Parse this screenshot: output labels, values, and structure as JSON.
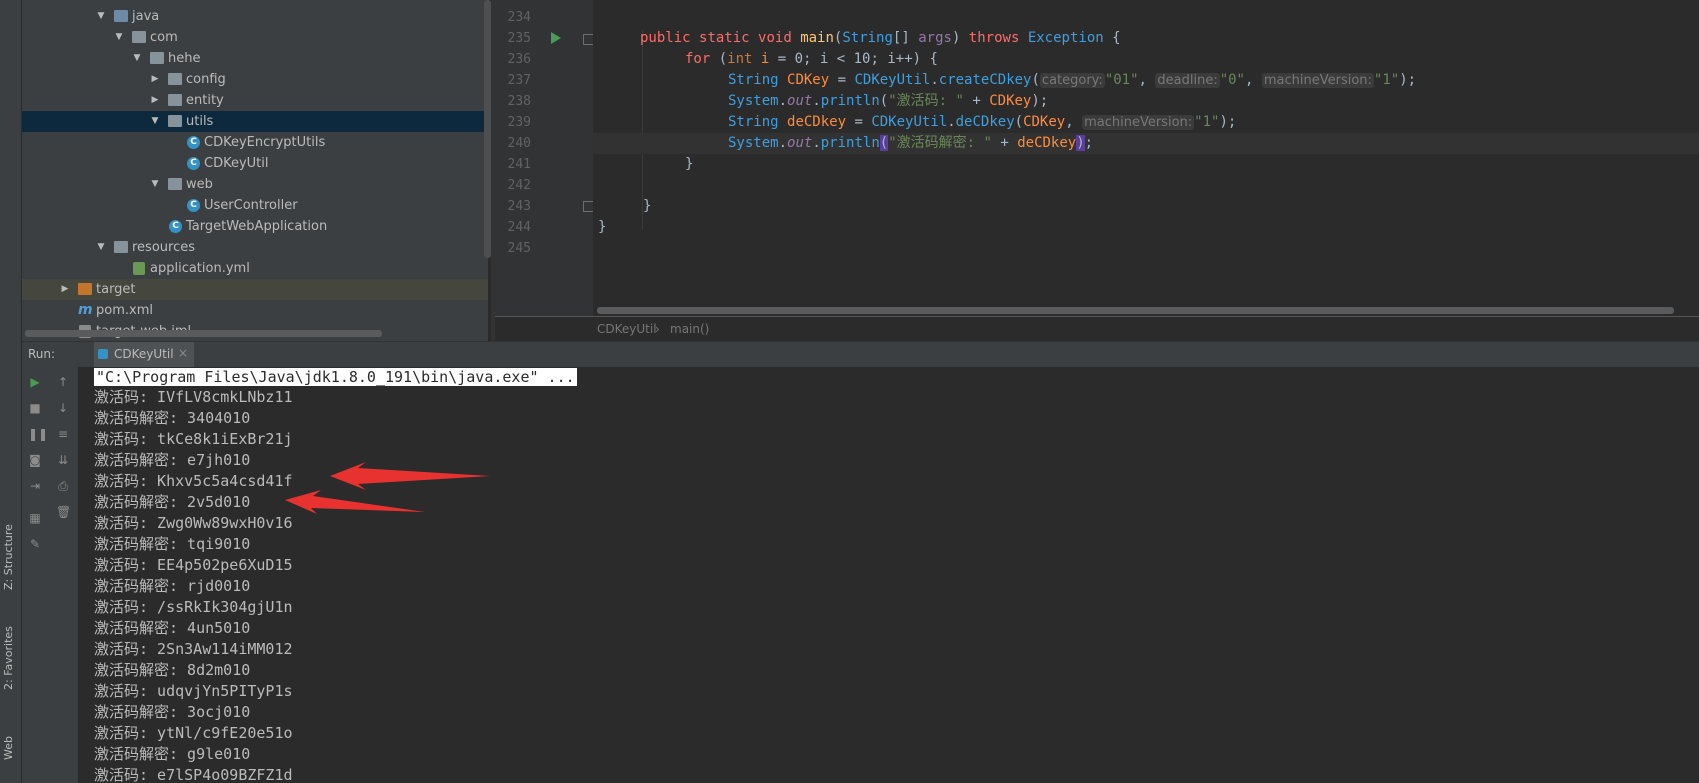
{
  "left_strip": {
    "structure": "Z: Structure",
    "favorites": "2: Favorites",
    "web": "Web"
  },
  "tree": {
    "items": [
      {
        "label": "java"
      },
      {
        "label": "com"
      },
      {
        "label": "hehe"
      },
      {
        "label": "config"
      },
      {
        "label": "entity"
      },
      {
        "label": "utils"
      },
      {
        "label": "CDKeyEncryptUtils"
      },
      {
        "label": "CDKeyUtil"
      },
      {
        "label": "web"
      },
      {
        "label": "UserController"
      },
      {
        "label": "TargetWebApplication"
      },
      {
        "label": "resources"
      },
      {
        "label": "application.yml"
      },
      {
        "label": "target"
      },
      {
        "label": "pom.xml"
      },
      {
        "label": "target-web.iml"
      }
    ]
  },
  "editor": {
    "line_numbers": [
      "234",
      "235",
      "236",
      "237",
      "238",
      "239",
      "240",
      "241",
      "242",
      "243",
      "244",
      "245"
    ],
    "hints": {
      "category": "category:",
      "deadline": "deadline:",
      "machineVersion": "machineVersion:",
      "machineVersion2": "machineVersion:"
    },
    "code": {
      "l235_public": "public",
      "l235_static": "static",
      "l235_void": "void",
      "l235_main": "main",
      "l235_String": "String",
      "l235_args": "args",
      "l235_throws": "throws",
      "l235_exc": "Exception",
      "l236_for": "for",
      "l236_int": "int",
      "l236_i": "i",
      "l236_rest": " = 0; i < 10; i++) {",
      "l237_String": "String",
      "l237_var": "CDKey",
      "l237_util": "CDKeyUtil",
      "l237_fn": "createCDkey",
      "l237_s1": "\"01\"",
      "l237_s2": "\"0\"",
      "l237_s3": "\"1\"",
      "l238_System": "System",
      "l238_out": "out",
      "l238_println": "println",
      "l238_str": "\"激活码: \"",
      "l238_var": "CDKey",
      "l239_String": "String",
      "l239_var": "deCDkey",
      "l239_util": "CDKeyUtil",
      "l239_fn": "deCDkey",
      "l239_arg": "CDKey",
      "l239_s": "\"1\"",
      "l240_System": "System",
      "l240_out": "out",
      "l240_println": "println",
      "l240_str": "\"激活码解密: \"",
      "l240_var": "deCDkey"
    },
    "breadcrumb": [
      "CDKeyUtil",
      "main()"
    ]
  },
  "run": {
    "label": "Run:",
    "tab": "CDKeyUtil",
    "command": "\"C:\\Program Files\\Java\\jdk1.8.0_191\\bin\\java.exe\" ...",
    "lines": [
      "激活码: IVfLV8cmkLNbz11",
      "激活码解密: 3404010",
      "激活码: tkCe8k1iExBr21j",
      "激活码解密: e7jh010",
      "激活码: Khxv5c5a4csd41f",
      "激活码解密: 2v5d010",
      "激活码: Zwg0Ww89wxH0v16",
      "激活码解密: tqi9010",
      "激活码: EE4p502pe6XuD15",
      "激活码解密: rjd0010",
      "激活码: /ssRkIk304gjU1n",
      "激活码解密: 4un5010",
      "激活码: 2Sn3Aw114iMM012",
      "激活码解密: 8d2m010",
      "激活码: udqvjYn5PITyP1s",
      "激活码解密: 3ocj010",
      "激活码: ytNl/c9fE20e51o",
      "激活码解密: g9le010",
      "激活码: e7lSP4o09BZFZ1d"
    ]
  },
  "colors": {
    "annotation_arrow": "#e8322f",
    "selection": "#0d293e"
  }
}
